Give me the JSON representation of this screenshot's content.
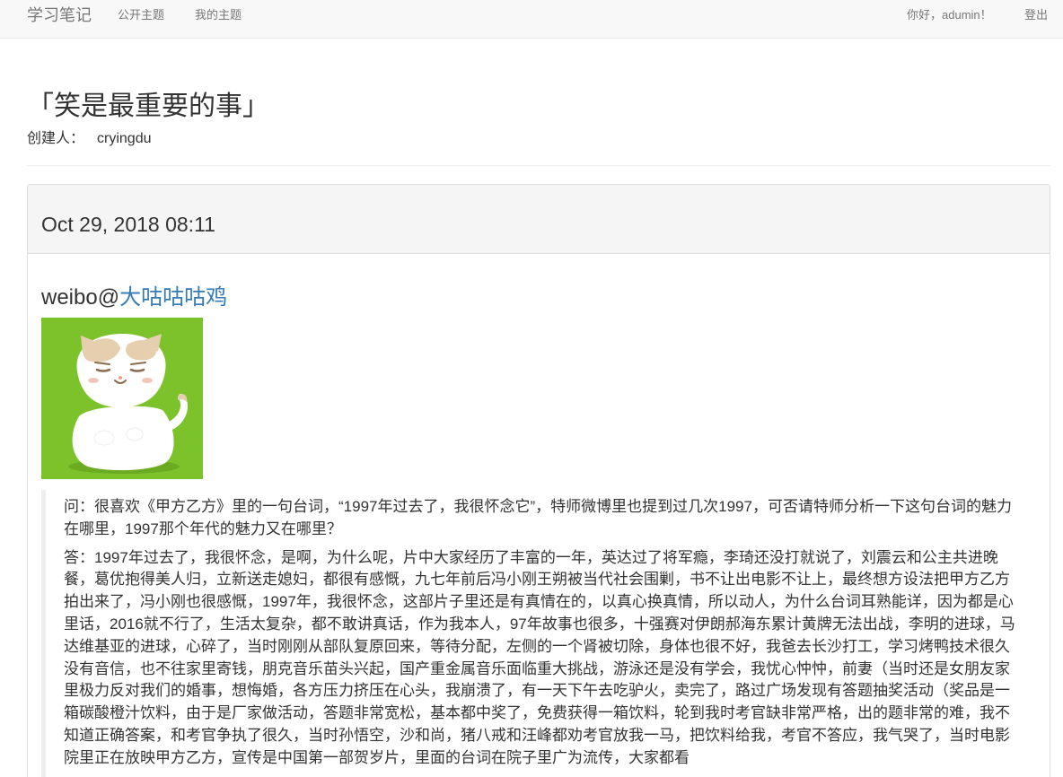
{
  "navbar": {
    "brand": "学习笔记",
    "public_topics": "公开主题",
    "my_topics": "我的主题",
    "greeting": "你好，adumin！",
    "logout": "登出"
  },
  "topic": {
    "title": "「笑是最重要的事」",
    "creator_label": "创建人：",
    "creator_name": "cryingdu"
  },
  "entry": {
    "date": "Oct 29, 2018 08:11",
    "weibo_prefix": "weibo@",
    "weibo_user": "大咕咕咕鸡",
    "question": "问：很喜欢《甲方乙方》里的一句台词，“1997年过去了，我很怀念它”，特师微博里也提到过几次1997，可否请特师分析一下这句台词的魅力在哪里，1997那个年代的魅力又在哪里？",
    "answer": "答：1997年过去了，我很怀念，是啊，为什么呢，片中大家经历了丰富的一年，英达过了将军瘾，李琦还没打就说了，刘震云和公主共进晚餐，葛优抱得美人归，立新送走媳妇，都很有感慨，九七年前后冯小刚王朔被当代社会围剿，书不让出电影不让上，最终想方设法把甲方乙方拍出来了，冯小刚也很感慨，1997年，我很怀念，这部片子里还是有真情在的，以真心换真情，所以动人，为什么台词耳熟能详，因为都是心里话，2016就不行了，生活太复杂，都不敢讲真话，作为我本人，97年故事也很多，十强赛对伊朗郝海东累计黄牌无法出战，李明的进球，马达维基亚的进球，心碎了，当时刚刚从部队复原回来，等待分配，左侧的一个肾被切除，身体也很不好，我爸去长沙打工，学习烤鸭技术很久没有音信，也不往家里寄钱，朋克音乐苗头兴起，国产重金属音乐面临重大挑战，游泳还是没有学会，我忧心忡忡，前妻（当时还是女朋友家里极力反对我们的婚事，想悔婚，各方压力挤压在心头，我崩溃了，有一天下午去吃驴火，卖完了，路过广场发现有答题抽奖活动（奖品是一箱碳酸橙汁饮料，由于是厂家做活动，答题非常宽松，基本都中奖了，免费获得一箱饮料，轮到我时考官缺非常严格，出的题非常的难，我不知道正确答案，和考官争执了很久，当时孙悟空，沙和尚，猪八戒和汪峰都劝考官放我一马，把饮料给我，考官不答应，我气哭了，当时电影院里正在放映甲方乙方，宣传是中国第一部贺岁片，里面的台词在院子里广为流传，大家都看"
  },
  "colors": {
    "link": "#337ab7",
    "image_background": "#7cc22a",
    "navbar_background": "#f8f8f8",
    "panel_heading_background": "#f5f5f5"
  },
  "icons": {
    "entry_image": "cat-illustration"
  }
}
